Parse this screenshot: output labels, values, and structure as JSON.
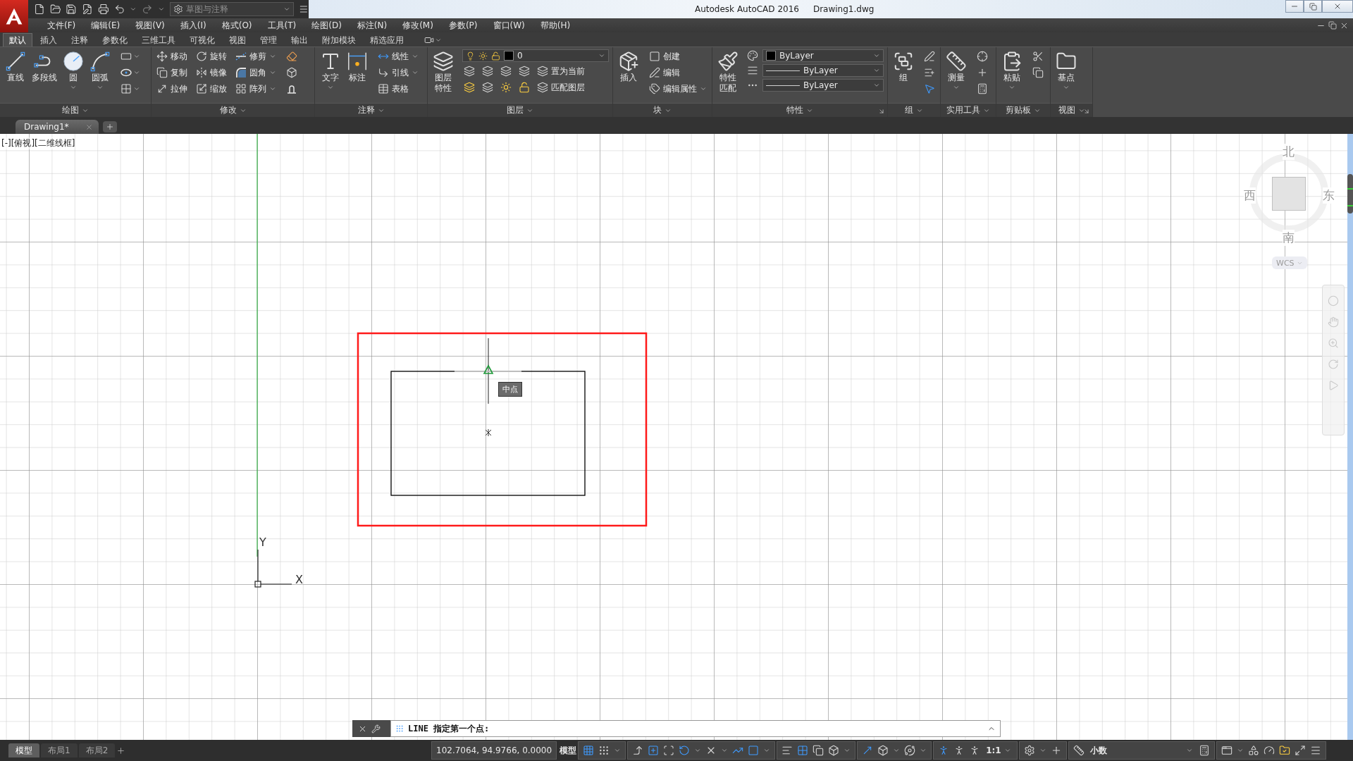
{
  "title_bar": {
    "workspace": "草图与注释",
    "app": "Autodesk AutoCAD 2016",
    "file": "Drawing1.dwg"
  },
  "menu": [
    "文件(F)",
    "编辑(E)",
    "视图(V)",
    "插入(I)",
    "格式(O)",
    "工具(T)",
    "绘图(D)",
    "标注(N)",
    "修改(M)",
    "参数(P)",
    "窗口(W)",
    "帮助(H)"
  ],
  "ribbon_tabs": [
    {
      "label": "默认",
      "selected": true
    },
    {
      "label": "插入",
      "selected": false
    },
    {
      "label": "注释",
      "selected": false
    },
    {
      "label": "参数化",
      "selected": false
    },
    {
      "label": "三维工具",
      "selected": false
    },
    {
      "label": "可视化",
      "selected": false
    },
    {
      "label": "视图",
      "selected": false
    },
    {
      "label": "管理",
      "selected": false
    },
    {
      "label": "输出",
      "selected": false
    },
    {
      "label": "附加模块",
      "selected": false
    },
    {
      "label": "精选应用",
      "selected": false
    }
  ],
  "panels": [
    {
      "kind": "draw",
      "title": "绘图",
      "large": [
        "直线",
        "多段线",
        "圆",
        "圆弧"
      ]
    },
    {
      "kind": "modify",
      "title": "修改",
      "small": [
        "移动",
        "旋转",
        "修剪",
        "复制",
        "镜像",
        "圆角",
        "拉伸",
        "缩放",
        "阵列"
      ]
    },
    {
      "kind": "annotate",
      "title": "注释",
      "large": [
        "文字",
        "标注"
      ],
      "small": [
        "线性",
        "引线",
        "表格"
      ]
    },
    {
      "kind": "layers",
      "title": "图层",
      "large": [
        "图层特性"
      ],
      "layer": "0",
      "small": [
        "置为当前",
        "匹配图层"
      ]
    },
    {
      "kind": "block",
      "title": "块",
      "large": [
        "插入"
      ],
      "small": [
        "创建",
        "编辑",
        "编辑属性"
      ]
    },
    {
      "kind": "properties",
      "title": "特性",
      "large": [
        "特性匹配"
      ],
      "dropdowns": [
        "ByLayer",
        "ByLayer",
        "ByLayer"
      ]
    },
    {
      "kind": "groups",
      "title": "组",
      "large": [
        "组"
      ]
    },
    {
      "kind": "utilities",
      "title": "实用工具",
      "large": [
        "测量"
      ]
    },
    {
      "kind": "clipboard",
      "title": "剪贴板",
      "large": [
        "粘贴"
      ]
    },
    {
      "kind": "view",
      "title": "视图",
      "large": [
        "基点"
      ]
    }
  ],
  "document_tabs": [
    {
      "label": "Drawing1*",
      "selected": true
    }
  ],
  "viewport": {
    "label": "[-][俯视][二维线框]",
    "compass": {
      "north": "北",
      "west": "西",
      "east": "东",
      "south": "南"
    },
    "ucs_menu": "WCS",
    "axis_y": "Y",
    "axis_x": "X",
    "snap_tooltip": "中点"
  },
  "command_line": {
    "prompt": "LINE 指定第一个点:"
  },
  "status_bar": {
    "layouts": [
      {
        "label": "模型",
        "selected": true
      },
      {
        "label": "布局1",
        "selected": false
      },
      {
        "label": "布局2",
        "selected": false
      }
    ],
    "coordinates": "102.7064, 94.9766, 0.0000",
    "space": "模型",
    "annotation_scale": "1:1",
    "units": "小数"
  }
}
